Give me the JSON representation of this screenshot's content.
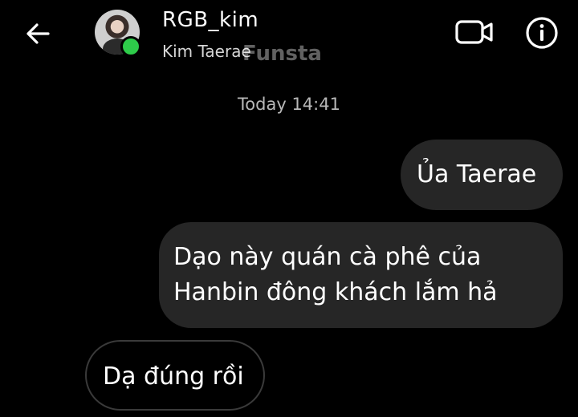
{
  "header": {
    "username": "RGB_kim",
    "fullname": "Kim Taerae",
    "watermark": "Funsta",
    "icons": [
      "back-arrow-icon",
      "video-call-icon",
      "info-icon"
    ],
    "online_color": "#2ecc4a"
  },
  "conversation": {
    "timestamp": "Today 14:41",
    "messages": [
      {
        "sender": "me",
        "text": "Ủa Taerae"
      },
      {
        "sender": "me",
        "text": "Dạo này quán cà phê của Hanbin đông khách lắm hả"
      },
      {
        "sender": "them",
        "text": "Dạ đúng rồi"
      }
    ]
  },
  "colors": {
    "background": "#000000",
    "bubble": "#262626",
    "text": "#ffffff"
  }
}
